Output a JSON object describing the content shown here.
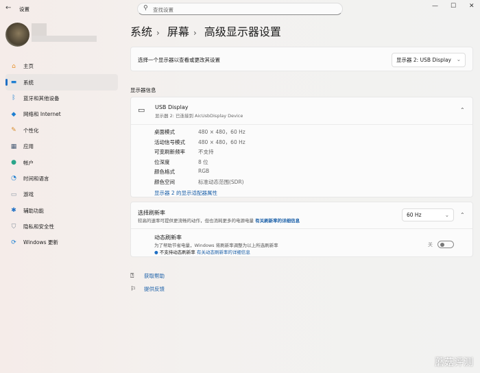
{
  "window": {
    "title": "设置",
    "back_icon": "←",
    "minimize": "—",
    "maximize": "☐",
    "close": "✕"
  },
  "search": {
    "placeholder": "查找设置"
  },
  "sidebar": {
    "items": [
      {
        "label": "主页",
        "icon": "⌂",
        "color": "#e8912d"
      },
      {
        "label": "系统",
        "icon": "▬",
        "color": "#1f7fd1"
      },
      {
        "label": "蓝牙和其他设备",
        "icon": "ᛒ",
        "color": "#1f7fd1"
      },
      {
        "label": "网络和 Internet",
        "icon": "◆",
        "color": "#1f7fd1"
      },
      {
        "label": "个性化",
        "icon": "✎",
        "color": "#d88a2a"
      },
      {
        "label": "应用",
        "icon": "▦",
        "color": "#465a75"
      },
      {
        "label": "帐户",
        "icon": "●",
        "color": "#2aa58a"
      },
      {
        "label": "时间和语言",
        "icon": "◔",
        "color": "#1f7fd1"
      },
      {
        "label": "游戏",
        "icon": "▭",
        "color": "#8a96a5"
      },
      {
        "label": "辅助功能",
        "icon": "✱",
        "color": "#1f6fc4"
      },
      {
        "label": "隐私和安全性",
        "icon": "⛉",
        "color": "#7c8796"
      },
      {
        "label": "Windows 更新",
        "icon": "⟳",
        "color": "#1f7fd1"
      }
    ]
  },
  "breadcrumb": [
    "系统",
    "屏幕",
    "高级显示器设置"
  ],
  "select_display": {
    "label": "选择一个显示器以查看或更改其设置",
    "value": "显示器 2: USB Display"
  },
  "section_title": "显示器信息",
  "display": {
    "name": "USB Display",
    "sub": "显示器 2: 已连接到 AicUsbDisplay Device",
    "rows": [
      {
        "k": "桌面模式",
        "v": "480 × 480，60 Hz"
      },
      {
        "k": "活动信号模式",
        "v": "480 × 480，60 Hz"
      },
      {
        "k": "可变刷新频率",
        "v": "不支持"
      },
      {
        "k": "位深度",
        "v": "8 位"
      },
      {
        "k": "颜色格式",
        "v": "RGB"
      },
      {
        "k": "颜色空间",
        "v": "标准动态范围(SDR)"
      }
    ],
    "adapter_link": "显示器 2 的显示适配器属性"
  },
  "refresh": {
    "title": "选择刷新率",
    "desc": "较高的速率可提供更流畅的动作，但也消耗更多的电源电量",
    "link": "有关刷新率的详细信息",
    "value": "60 Hz",
    "dynamic": {
      "title": "动态刷新率",
      "desc": "为了帮助节省电量，Windows 将刷新率调整为以上所选刷新率",
      "note": "不支持动态刷新率",
      "note_link": "有关动态刷新率的详细信息",
      "toggle_label": "关",
      "toggle_on": false
    }
  },
  "footer": {
    "help": "获取帮助",
    "feedback": "提供反馈"
  },
  "watermark": "蘑菇评测"
}
